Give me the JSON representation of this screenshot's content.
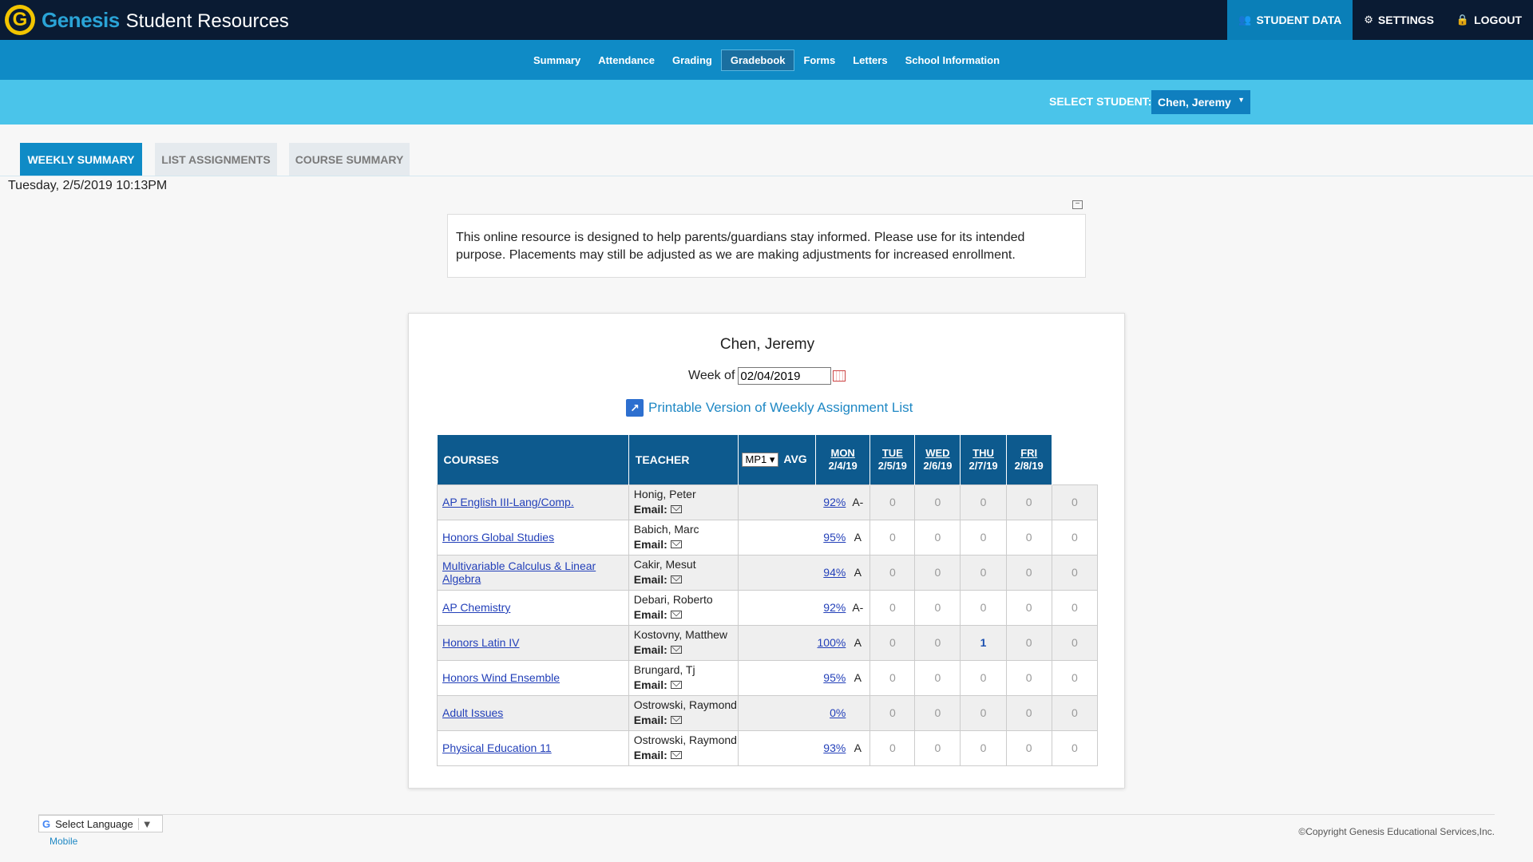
{
  "header": {
    "brand_name": "Genesis",
    "brand_subtitle": "Student Resources",
    "buttons": [
      {
        "label": "STUDENT DATA",
        "icon": "users-icon"
      },
      {
        "label": "SETTINGS",
        "icon": "gear-icon"
      },
      {
        "label": "LOGOUT",
        "icon": "lock-icon"
      }
    ]
  },
  "nav": {
    "items": [
      "Summary",
      "Attendance",
      "Grading",
      "Gradebook",
      "Forms",
      "Letters",
      "School Information"
    ],
    "active": "Gradebook"
  },
  "student_select": {
    "label": "SELECT STUDENT:",
    "value": "Chen, Jeremy"
  },
  "subtabs": [
    "WEEKLY SUMMARY",
    "LIST ASSIGNMENTS",
    "COURSE SUMMARY"
  ],
  "datetime": "Tuesday, 2/5/2019 10:13PM",
  "notice": "This online resource is designed to help parents/guardians stay informed. Please use for its intended purpose. Placements may still be adjusted as we are making adjustments for increased enrollment.",
  "card": {
    "student_name": "Chen, Jeremy",
    "week_label": "Week of",
    "week_value": "02/04/2019",
    "printable_label": "Printable Version of Weekly Assignment List"
  },
  "table": {
    "col_courses": "COURSES",
    "col_teacher": "TEACHER",
    "mp_value": "MP1",
    "col_avg": "AVG",
    "days": [
      {
        "day": "MON",
        "date": "2/4/19"
      },
      {
        "day": "TUE",
        "date": "2/5/19"
      },
      {
        "day": "WED",
        "date": "2/6/19"
      },
      {
        "day": "THU",
        "date": "2/7/19"
      },
      {
        "day": "FRI",
        "date": "2/8/19"
      }
    ],
    "email_label": "Email:",
    "rows": [
      {
        "course": "AP English III-Lang/Comp.",
        "teacher": "Honig, Peter",
        "pct": "92%",
        "grade": "A-",
        "days": [
          "0",
          "0",
          "0",
          "0",
          "0"
        ]
      },
      {
        "course": "Honors Global Studies",
        "teacher": "Babich, Marc",
        "pct": "95%",
        "grade": "A",
        "days": [
          "0",
          "0",
          "0",
          "0",
          "0"
        ]
      },
      {
        "course": "Multivariable Calculus & Linear Algebra",
        "teacher": "Cakir, Mesut",
        "pct": "94%",
        "grade": "A",
        "days": [
          "0",
          "0",
          "0",
          "0",
          "0"
        ]
      },
      {
        "course": "AP Chemistry",
        "teacher": "Debari, Roberto",
        "pct": "92%",
        "grade": "A-",
        "days": [
          "0",
          "0",
          "0",
          "0",
          "0"
        ]
      },
      {
        "course": "Honors Latin IV",
        "teacher": "Kostovny, Matthew",
        "pct": "100%",
        "grade": "A",
        "days": [
          "0",
          "0",
          "1",
          "0",
          "0"
        ]
      },
      {
        "course": "Honors Wind Ensemble",
        "teacher": "Brungard, Tj",
        "pct": "95%",
        "grade": "A",
        "days": [
          "0",
          "0",
          "0",
          "0",
          "0"
        ]
      },
      {
        "course": "Adult Issues",
        "teacher": "Ostrowski, Raymond",
        "pct": "0%",
        "grade": "",
        "days": [
          "0",
          "0",
          "0",
          "0",
          "0"
        ]
      },
      {
        "course": "Physical Education 11",
        "teacher": "Ostrowski, Raymond",
        "pct": "93%",
        "grade": "A",
        "days": [
          "0",
          "0",
          "0",
          "0",
          "0"
        ]
      }
    ]
  },
  "footer": {
    "language_label": "Select Language",
    "mobile_label": "Mobile",
    "copyright": "©Copyright Genesis Educational Services,Inc."
  },
  "colors": {
    "header_bg": "#0a1b33",
    "nav_bg": "#0f8bc6",
    "student_bar_bg": "#4ac4ea",
    "table_header_bg": "#0d5a8e",
    "link": "#2340b9",
    "logo_yellow": "#f2c500"
  }
}
